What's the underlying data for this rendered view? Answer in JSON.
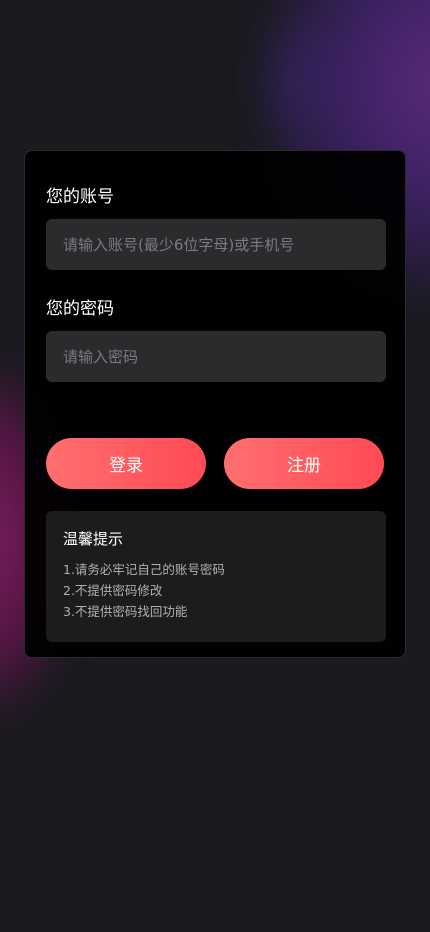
{
  "form": {
    "account_label": "您的账号",
    "account_placeholder": "请输入账号(最少6位字母)或手机号",
    "account_value": "",
    "password_label": "您的密码",
    "password_placeholder": "请输入密码",
    "password_value": ""
  },
  "actions": {
    "login_label": "登录",
    "register_label": "注册"
  },
  "tips": {
    "title": "温馨提示",
    "lines": [
      "1.请务必牢记自己的账号密码",
      "2.不提供密码修改",
      "3.不提供密码找回功能"
    ]
  },
  "colors": {
    "button_gradient_start": "#ff6f6f",
    "button_gradient_end": "#ff4a55",
    "card_background": "#000000",
    "input_background": "#2b2b2e"
  }
}
